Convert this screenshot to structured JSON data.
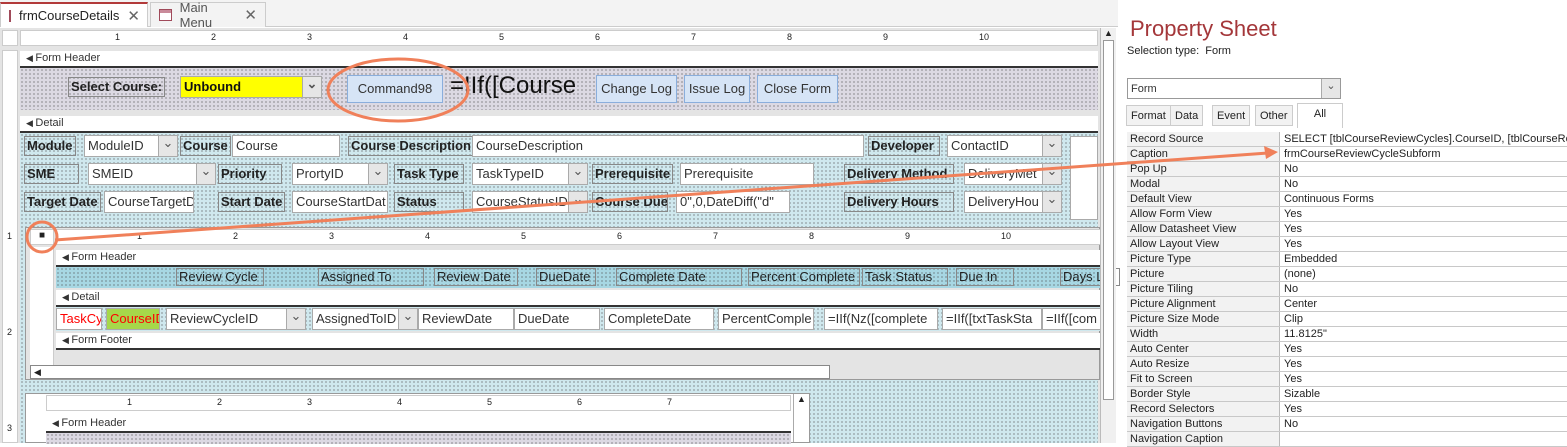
{
  "tabs": [
    {
      "label": "frmCourseDetails",
      "active": true
    },
    {
      "label": "Main Menu",
      "active": false
    }
  ],
  "ruler_marks": [
    "1",
    "2",
    "3",
    "4",
    "5",
    "6",
    "7",
    "8",
    "9",
    "10"
  ],
  "sub_ruler_marks": [
    "1",
    "2",
    "3",
    "4",
    "5",
    "6",
    "7",
    "8",
    "9",
    "10"
  ],
  "lower_ruler_marks": [
    "1",
    "2",
    "3",
    "4",
    "5",
    "6",
    "7"
  ],
  "vruler_marks": [
    "1",
    "2",
    "3"
  ],
  "main_form": {
    "form_header_label": "Form Header",
    "detail_label": "Detail",
    "select_course_label": "Select Course:",
    "select_course_value": "Unbound",
    "command_button": "Command98",
    "iif_expression": "=IIf([Course",
    "buttons": [
      "Change Log",
      "Issue Log",
      "Close Form"
    ],
    "fields": {
      "module_label": "Module",
      "module_value": "ModuleID",
      "course_label": "Course",
      "course_value": "Course",
      "course_desc_label": "Course Description",
      "course_desc_value": "CourseDescription",
      "developer_label": "Developer",
      "developer_value": "ContactID",
      "sme_label": "SME",
      "sme_value": "SMEID",
      "priority_label": "Priority",
      "priority_value": "PrortyID",
      "task_type_label": "Task Type",
      "task_type_value": "TaskTypeID",
      "prerequisite_label": "Prerequisite",
      "prerequisite_value": "Prerequisite",
      "delivery_method_label": "Delivery Method",
      "delivery_method_value": "DeliveryMet",
      "target_date_label": "Target Date",
      "target_date_value": "CourseTargetDa",
      "start_date_label": "Start Date",
      "start_date_value": "CourseStartDat",
      "status_label": "Status",
      "status_value": "CourseStatusID",
      "course_due_label": "Course Due",
      "course_due_value": "0\",0,DateDiff(\"d\"",
      "delivery_hours_label": "Delivery Hours",
      "delivery_hours_value": "DeliveryHou"
    }
  },
  "subform": {
    "form_header_label": "Form Header",
    "detail_label": "Detail",
    "form_footer_label": "Form Footer",
    "headers": [
      "Review Cycle",
      "Assigned To",
      "Review Date",
      "DueDate",
      "Complete Date",
      "Percent Complete",
      "Task Status",
      "Due In",
      "Days La"
    ],
    "detail_fields": [
      "TaskCyc",
      "CourseID",
      "ReviewCycleID",
      "AssignedToID",
      "ReviewDate",
      "DueDate",
      "CompleteDate",
      "PercentComple",
      "=IIf(Nz([complete",
      "=IIf([txtTaskSta",
      "=IIf([com"
    ]
  },
  "lower_subform": {
    "form_header_label": "Form Header"
  },
  "property_sheet": {
    "title": "Property Sheet",
    "selection_type_label": "Selection type:",
    "selection_type_value": "Form",
    "object_select": "Form",
    "tabs": [
      "Format",
      "Data",
      "Event",
      "Other",
      "All"
    ],
    "active_tab": "All",
    "rows": [
      [
        "Record Source",
        "SELECT [tblCourseReviewCycles].CourseID, [tblCourseRe"
      ],
      [
        "Caption",
        "frmCourseReviewCycleSubform"
      ],
      [
        "Pop Up",
        "No"
      ],
      [
        "Modal",
        "No"
      ],
      [
        "Default View",
        "Continuous Forms"
      ],
      [
        "Allow Form View",
        "Yes"
      ],
      [
        "Allow Datasheet View",
        "Yes"
      ],
      [
        "Allow Layout View",
        "Yes"
      ],
      [
        "Picture Type",
        "Embedded"
      ],
      [
        "Picture",
        "(none)"
      ],
      [
        "Picture Tiling",
        "No"
      ],
      [
        "Picture Alignment",
        "Center"
      ],
      [
        "Picture Size Mode",
        "Clip"
      ],
      [
        "Width",
        "11.8125\""
      ],
      [
        "Auto Center",
        "Yes"
      ],
      [
        "Auto Resize",
        "Yes"
      ],
      [
        "Fit to Screen",
        "Yes"
      ],
      [
        "Border Style",
        "Sizable"
      ],
      [
        "Record Selectors",
        "Yes"
      ],
      [
        "Navigation Buttons",
        "No"
      ],
      [
        "Navigation Caption",
        ""
      ]
    ]
  },
  "colors": {
    "accent": "#b23a3a",
    "annotation": "#f0805a",
    "unbound_bg": "#ffff00",
    "course_id_bg": "#a6d84a",
    "red_text": "#ff0000"
  }
}
